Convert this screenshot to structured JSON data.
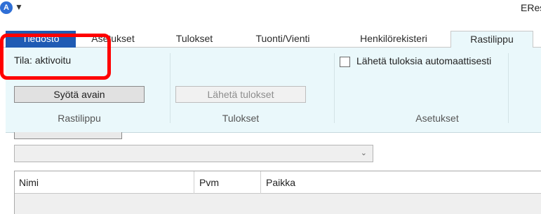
{
  "titlebar": {
    "app_icon_letter": "A",
    "app_icon": "app-logo-icon",
    "qat_icon": "quick-access-dropdown-icon",
    "title": "ERes"
  },
  "tabs": [
    {
      "label": "Tiedosto"
    },
    {
      "label": "Asetukset"
    },
    {
      "label": "Tulokset"
    },
    {
      "label": "Tuonti/Vienti"
    },
    {
      "label": "Henkilörekisteri"
    },
    {
      "label": "Rastilippu"
    }
  ],
  "active_tab": "Rastilippu",
  "ribbon": {
    "status": "Tila: aktivoitu",
    "enter_key_button": "Syötä avain",
    "send_results_button": "Lähetä tulokset",
    "auto_send_checkbox": "Lähetä tuloksia automaattisesti",
    "auto_send_checked": false,
    "groups": [
      {
        "label": "Rastilippu"
      },
      {
        "label": "Tulokset"
      },
      {
        "label": "Asetukset"
      }
    ]
  },
  "combo": {
    "value": "",
    "arrow_icon": "chevron-down-icon"
  },
  "grid": {
    "columns": [
      "Nimi",
      "Pvm",
      "Paikka"
    ]
  },
  "colors": {
    "file_tab": "#1f5bb4",
    "ribbon_bg": "#eaf8fb",
    "highlight": "#ff0000"
  }
}
